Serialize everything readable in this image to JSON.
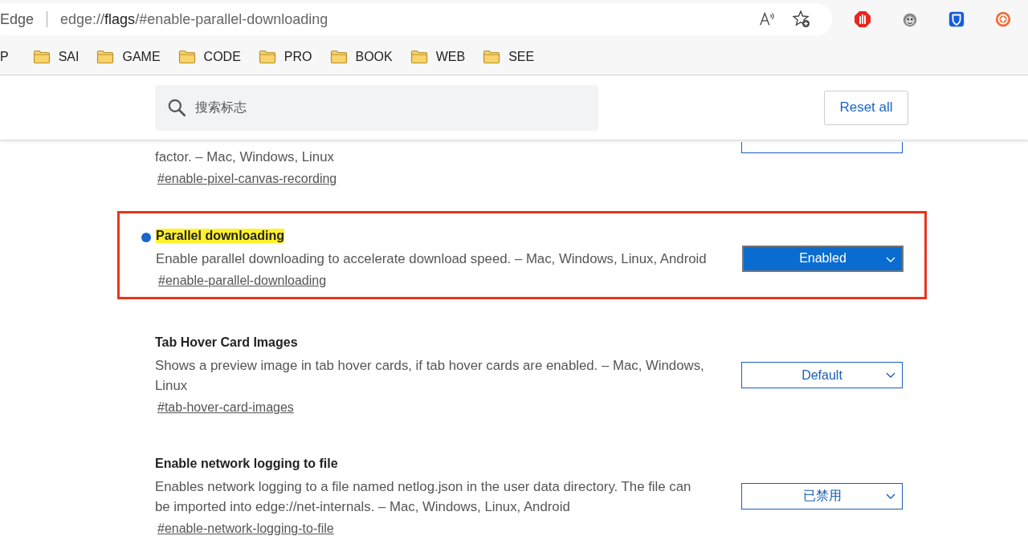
{
  "address_bar": {
    "site_label": "Edge",
    "url": "edge://**flags**/#enable-parallel-downloading"
  },
  "bookmarks": [
    {
      "label": "P",
      "folder": false
    },
    {
      "label": "SAI",
      "folder": true
    },
    {
      "label": "GAME",
      "folder": true
    },
    {
      "label": "CODE",
      "folder": true
    },
    {
      "label": "PRO",
      "folder": true
    },
    {
      "label": "BOOK",
      "folder": true
    },
    {
      "label": "WEB",
      "folder": true
    },
    {
      "label": "SEE",
      "folder": true
    }
  ],
  "search": {
    "placeholder": "搜索标志"
  },
  "reset_button": "Reset all",
  "flags": [
    {
      "description": "factor. – Mac, Windows, Linux",
      "link": "#enable-pixel-canvas-recording",
      "active": false
    },
    {
      "title": "Parallel downloading",
      "description": "Enable parallel downloading to accelerate download speed. – Mac, Windows, Linux, Android",
      "link": "#enable-parallel-downloading",
      "dropdown": "Enabled",
      "active": true,
      "modified": true,
      "highlighted": true,
      "outlined": true
    },
    {
      "title": "Tab Hover Card Images",
      "description": "Shows a preview image in tab hover cards, if tab hover cards are enabled. – Mac, Windows, Linux",
      "link": "#tab-hover-card-images",
      "dropdown": "Default",
      "active": false
    },
    {
      "title": "Enable network logging to file",
      "description": "Enables network logging to a file named netlog.json in the user data directory. The file can be imported into edge://net-internals. – Mac, Windows, Linux, Android",
      "link": "#enable-network-logging-to-file",
      "dropdown": "已禁用",
      "active": false
    }
  ]
}
